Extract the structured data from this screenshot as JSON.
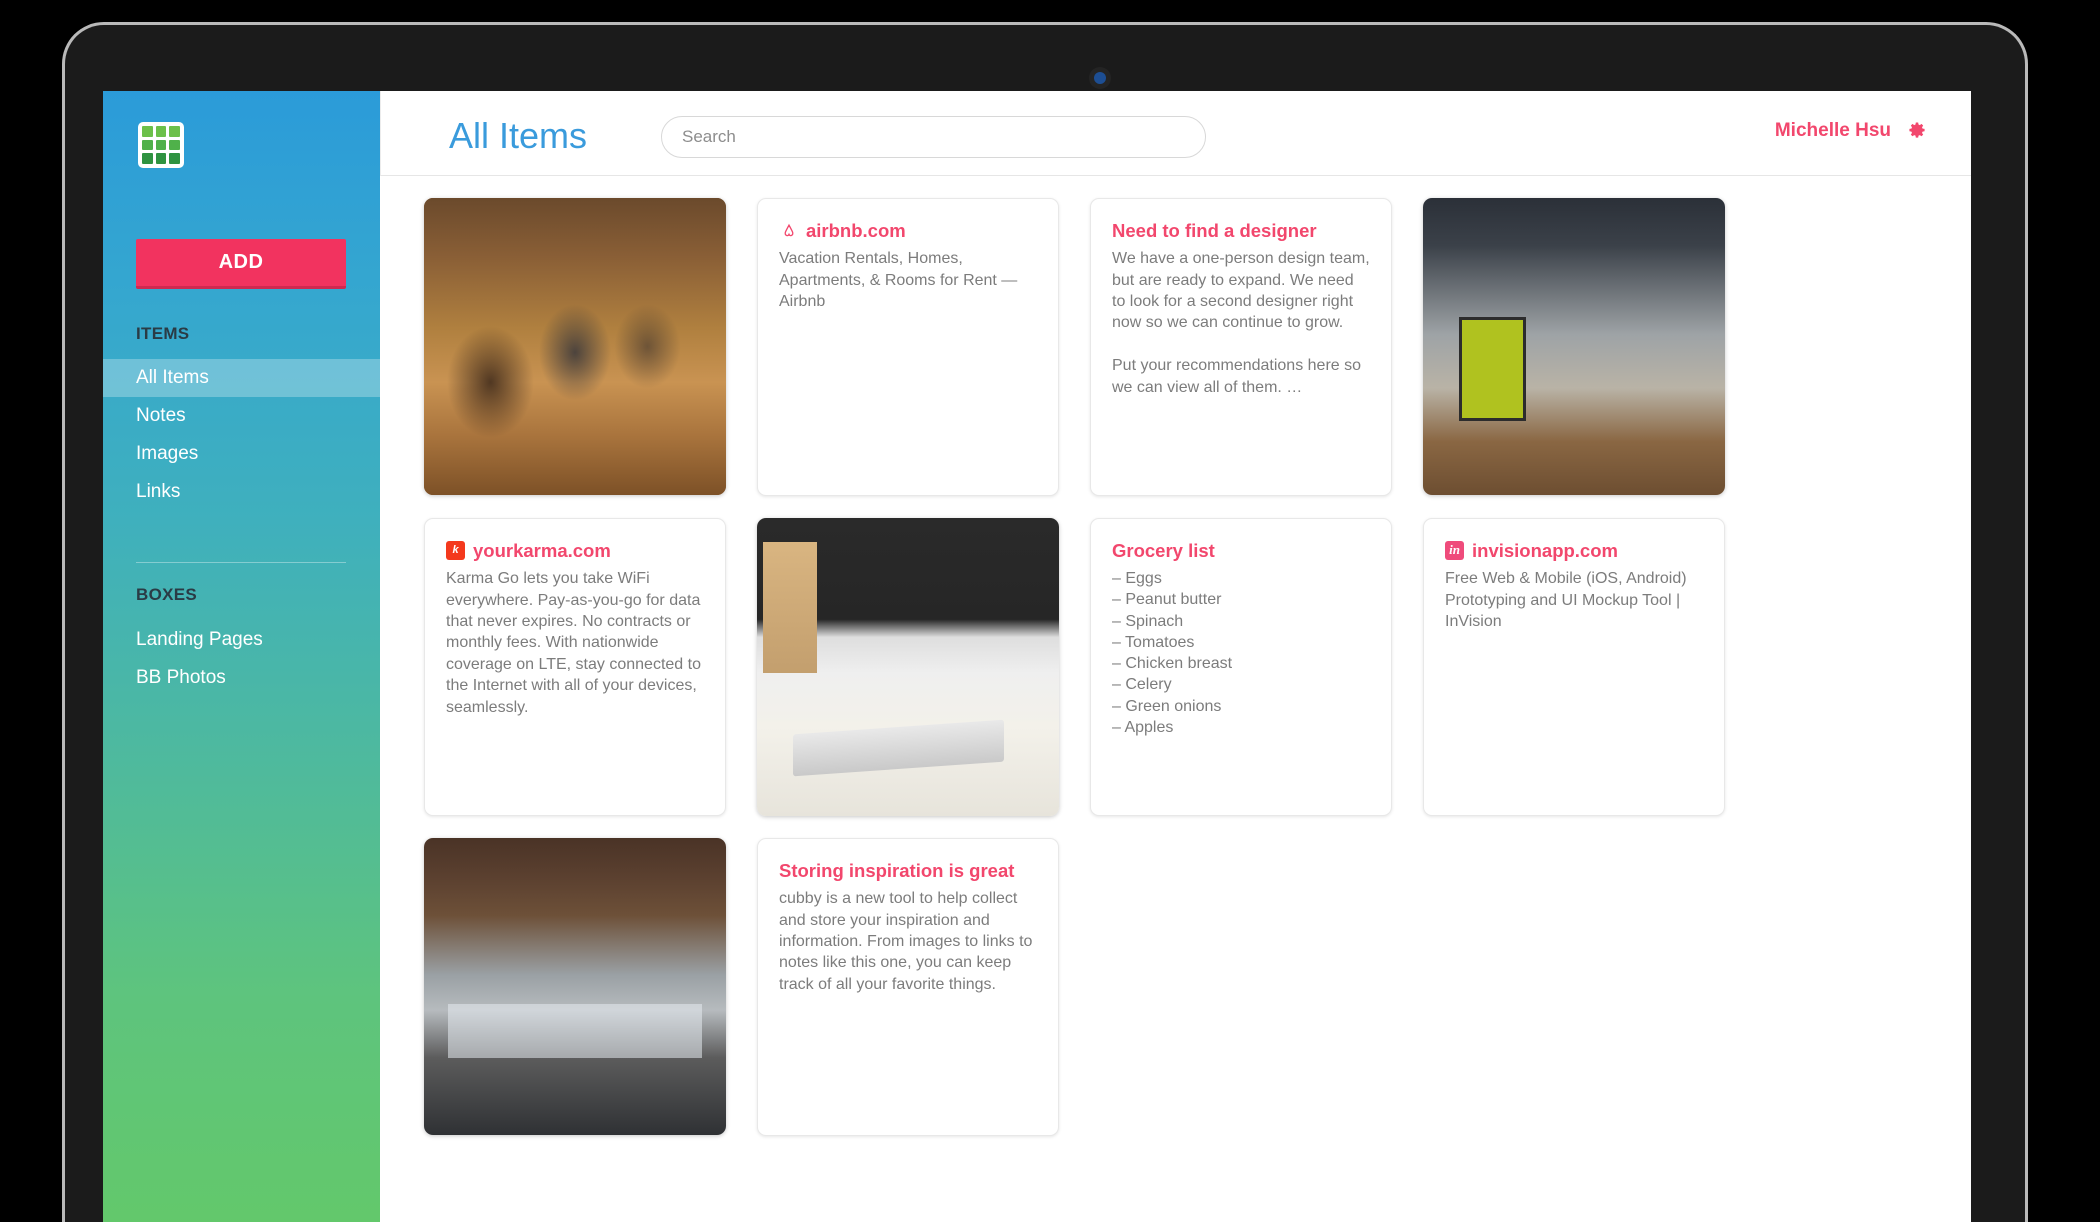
{
  "device": {
    "camera_icon": "camera-dot"
  },
  "sidebar": {
    "logo_icon": "grid-logo-icon",
    "add_label": "ADD",
    "sections": [
      {
        "heading": "ITEMS",
        "items": [
          {
            "label": "All Items",
            "active": true
          },
          {
            "label": "Notes",
            "active": false
          },
          {
            "label": "Images",
            "active": false
          },
          {
            "label": "Links",
            "active": false
          }
        ]
      },
      {
        "heading": "BOXES",
        "items": [
          {
            "label": "Landing Pages",
            "active": false
          },
          {
            "label": "BB Photos",
            "active": false
          }
        ]
      }
    ],
    "gradient_top": "#2b9bd9",
    "gradient_bottom": "#63c86b",
    "add_button_color": "#f2335f"
  },
  "topbar": {
    "title": "All Items",
    "title_color": "#3a9bdc",
    "search_placeholder": "Search",
    "search_value": "",
    "user_name": "Michelle Hsu",
    "user_name_color": "#f2476d",
    "gear_icon": "gear-icon"
  },
  "cards": [
    {
      "id": "photo-bar",
      "type": "photo",
      "image_name": "wine-bar-barrels-photo",
      "alt": "People seated at a bar with wine barrel stools"
    },
    {
      "id": "link-airbnb",
      "type": "link",
      "favicon": "airbnb-belo-icon",
      "title": "airbnb.com",
      "body": "Vacation Rentals, Homes, Apartments, & Rooms for Rent — Airbnb"
    },
    {
      "id": "note-designer",
      "type": "note",
      "title": "Need to find a designer",
      "body": "We have a one-person design team, but are ready to expand. We need to look for a second designer right now so we can continue to grow.\n\nPut your recommendations here so we can view all of them. …"
    },
    {
      "id": "photo-office-green",
      "type": "photo",
      "image_name": "office-hallway-green-poster-photo",
      "alt": "Office hallway with framed green poster"
    },
    {
      "id": "link-yourkarma",
      "type": "link",
      "favicon": "karma-icon",
      "favicon_letter": "k",
      "favicon_color": "#f4391d",
      "title": "yourkarma.com",
      "body": "Karma Go lets you take WiFi everywhere. Pay-as-you-go for data that never expires. No contracts or monthly fees. With nationwide coverage on LTE, stay connected to the Internet with all of your devices, seamlessly."
    },
    {
      "id": "photo-imac",
      "type": "photo",
      "image_name": "imac-desk-keyboard-photo",
      "alt": "iMac and keyboard on a white desk"
    },
    {
      "id": "note-grocery",
      "type": "list",
      "title": "Grocery list",
      "items": [
        "– Eggs",
        "– Peanut butter",
        "– Spinach",
        "– Tomatoes",
        "– Chicken breast",
        "– Celery",
        "– Green onions",
        "– Apples"
      ]
    },
    {
      "id": "link-invision",
      "type": "link",
      "favicon": "invision-icon",
      "favicon_letter": "in",
      "favicon_color": "#ef4b7b",
      "title": "invisionapp.com",
      "body": "Free Web & Mobile (iOS, Android) Prototyping and UI Mockup Tool | InVision"
    },
    {
      "id": "photo-office-dark",
      "type": "photo",
      "image_name": "open-plan-office-desks-photo",
      "alt": "Open plan office with desks and chairs"
    },
    {
      "id": "note-inspiration",
      "type": "note",
      "title": "Storing inspiration is great",
      "body": "cubby is a new tool to help collect and store your inspiration and information. From images to links to notes like this one, you can keep track of all your favorite things."
    }
  ]
}
